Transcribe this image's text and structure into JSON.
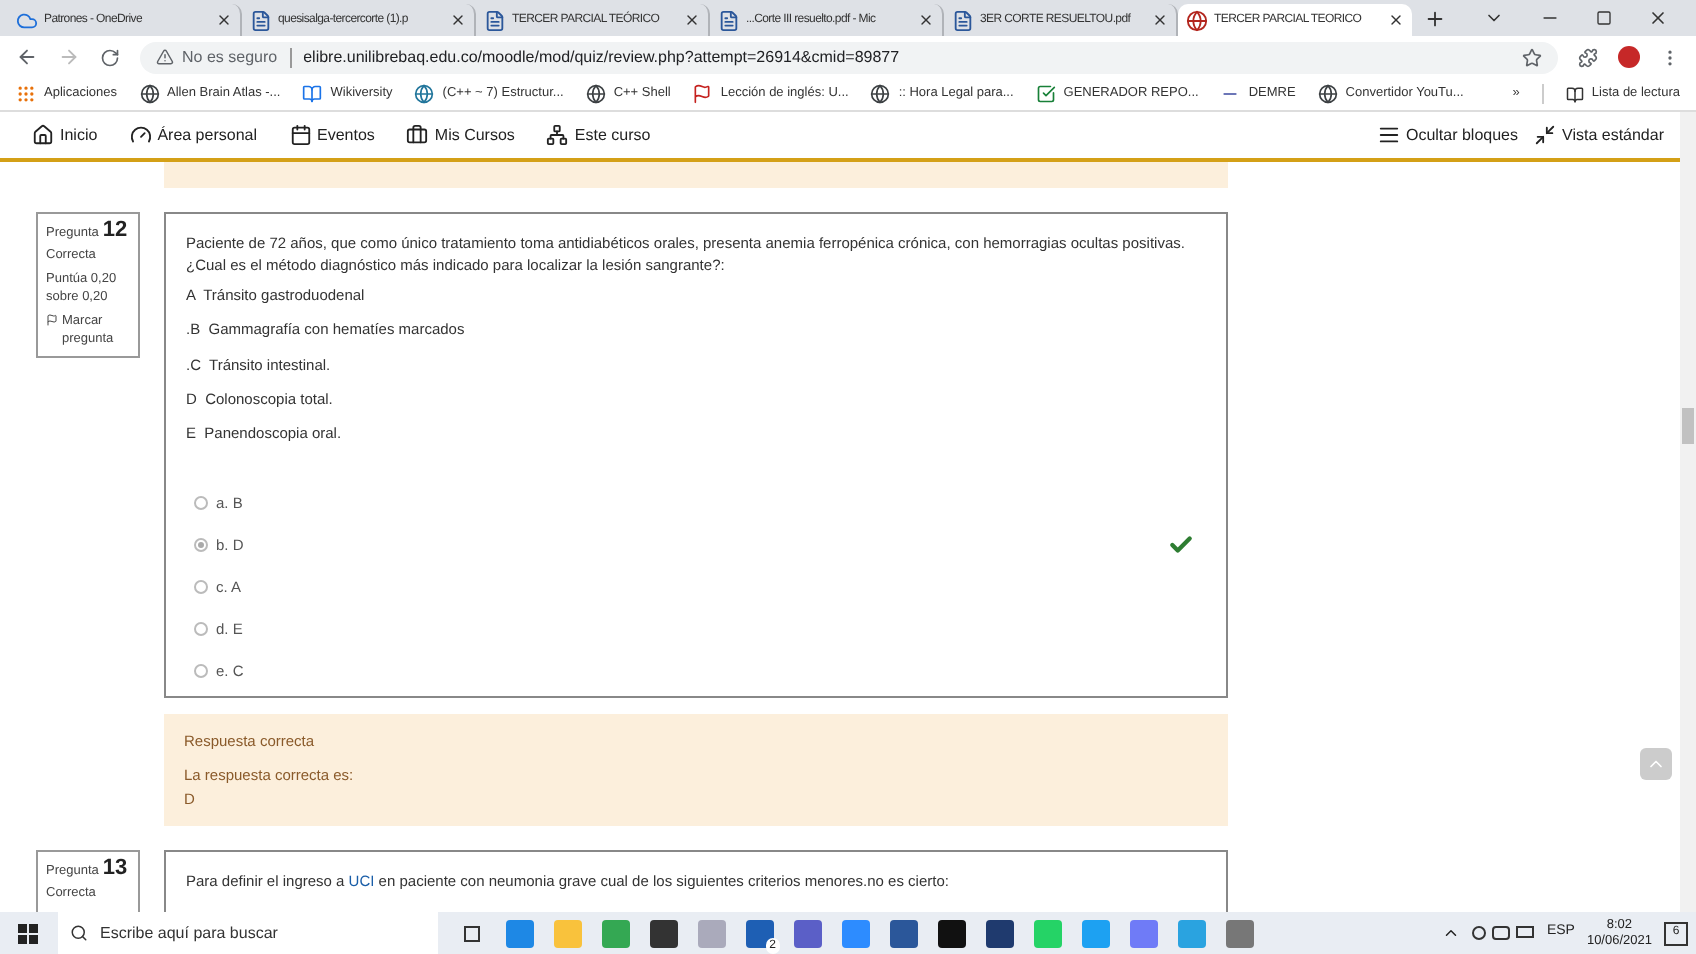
{
  "browser": {
    "tabs": [
      {
        "title": "Patrones - OneDrive",
        "kind": "cloud",
        "selected": false
      },
      {
        "title": "quesisalga-tercercorte (1).p",
        "kind": "doc",
        "selected": false
      },
      {
        "title": "TERCER PARCIAL TEÓRICO",
        "kind": "doc",
        "selected": false
      },
      {
        "title": "...Corte III resuelto.pdf - Mic",
        "kind": "doc",
        "selected": false
      },
      {
        "title": "3ER CORTE RESUELTOU.pdf",
        "kind": "doc",
        "selected": false
      },
      {
        "title": "TERCER PARCIAL TEORICO",
        "kind": "site",
        "selected": true
      }
    ],
    "security": "No es seguro",
    "url": "elibre.unilibrebaq.edu.co/moodle/mod/quiz/review.php?attempt=26914&cmid=89877",
    "bookmarks": [
      {
        "label": "Aplicaciones",
        "kind": "apps"
      },
      {
        "label": "Allen Brain Atlas -...",
        "kind": "globe"
      },
      {
        "label": "Wikiversity",
        "kind": "wiki"
      },
      {
        "label": "(C++ ~ 7) Estructur...",
        "kind": "wp"
      },
      {
        "label": "C++ Shell",
        "kind": "globe"
      },
      {
        "label": "Lección de inglés: U...",
        "kind": "flag"
      },
      {
        "label": ":: Hora Legal para...",
        "kind": "globe"
      },
      {
        "label": "GENERADOR REPO...",
        "kind": "check"
      },
      {
        "label": "DEMRE",
        "kind": "line"
      },
      {
        "label": "Convertidor YouTu...",
        "kind": "globe"
      }
    ],
    "bookmarks_overflow": "»",
    "reading_list": "Lista de lectura"
  },
  "nav": {
    "items": [
      {
        "label": "Inicio",
        "kind": "home"
      },
      {
        "label": "Área personal",
        "kind": "gauge"
      },
      {
        "label": "Eventos",
        "kind": "calendar"
      },
      {
        "label": "Mis Cursos",
        "kind": "briefcase"
      },
      {
        "label": "Este curso",
        "kind": "sitemap"
      }
    ],
    "right": [
      {
        "label": "Ocultar bloques",
        "kind": "list"
      },
      {
        "label": "Vista estándar",
        "kind": "shrink"
      }
    ]
  },
  "questions": [
    {
      "heading": "Pregunta",
      "number": "12",
      "state": "Correcta",
      "score": "Puntúa 0,20 sobre 0,20",
      "flag": "Marcar pregunta",
      "text": "Paciente de 72 años, que como único tratamiento toma antidiabéticos orales, presenta anemia ferropénica crónica, con hemorragias ocultas positivas.¿Cual es el método diagnóstico más indicado para localizar la lesión sangrante?:",
      "lines": [
        "A  Tránsito gastroduodenal",
        ".B  Gammagrafía con hematíes marcados",
        ".C  Tránsito intestinal.",
        "D  Colonoscopia total.",
        "E  Panendoscopia oral."
      ],
      "answers": [
        {
          "label": "a. B",
          "selected": false
        },
        {
          "label": "b. D",
          "selected": true
        },
        {
          "label": "c. A",
          "selected": false
        },
        {
          "label": "d. E",
          "selected": false
        },
        {
          "label": "e. C",
          "selected": false
        }
      ],
      "correct": true,
      "feedback": {
        "title": "Respuesta correcta",
        "lines": [
          "La respuesta correcta es:",
          "D"
        ]
      }
    },
    {
      "heading": "Pregunta",
      "number": "13",
      "state": "Correcta",
      "text_before": "Para definir el ingreso a ",
      "text_link": "UCI",
      "text_after": " en paciente con neumonia grave cual de los siguientes criterios menores.no es cierto:"
    }
  ],
  "taskbar": {
    "search": "Escribe aquí para buscar",
    "mail_badge": "2",
    "lang": "ESP",
    "time": "8:02",
    "date": "10/06/2021",
    "notifications": "6"
  }
}
